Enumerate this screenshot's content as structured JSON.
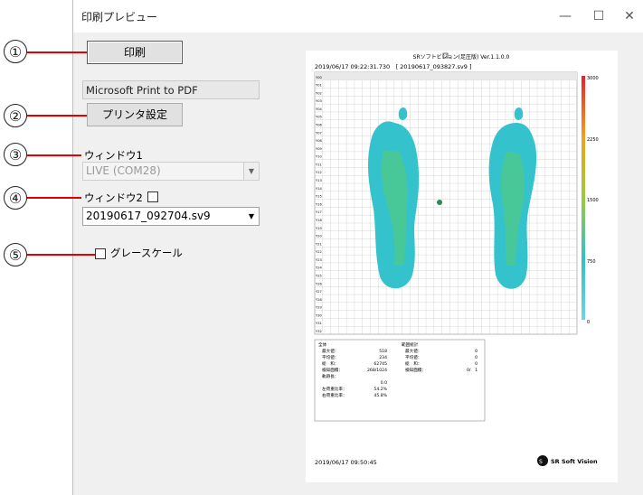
{
  "window": {
    "title": "印刷プレビュー",
    "min_glyph": "—",
    "max_glyph": "☐",
    "close_glyph": "✕"
  },
  "left": {
    "print_button": "印刷",
    "printer_name": "Microsoft Print to PDF",
    "printer_settings_button": "プリンタ設定",
    "window1_label": "ウィンドウ1",
    "window1_value": "LIVE (COM28)",
    "window2_label": "ウィンドウ2",
    "window2_checked": false,
    "window2_value": "20190617_092704.sv9",
    "grayscale_label": "グレースケール",
    "grayscale_checked": false
  },
  "callouts": [
    "①",
    "②",
    "③",
    "④",
    "⑤"
  ],
  "preview": {
    "header": "SRソフトビジョン(足圧版) Ver.1.1.0.0",
    "timestamp_line": "2019/06/17 09:22:31.730　[ 20190617_093827.sv9 ]",
    "row_labels": [
      "Y00",
      "Y01",
      "Y02",
      "Y03",
      "Y04",
      "Y05",
      "Y06",
      "Y07",
      "Y08",
      "Y09",
      "Y10",
      "Y11",
      "Y12",
      "Y13",
      "Y14",
      "Y15",
      "Y16",
      "Y17",
      "Y18",
      "Y19",
      "Y20",
      "Y21",
      "Y22",
      "Y23",
      "Y24",
      "Y25",
      "Y26",
      "Y27",
      "Y28",
      "Y29",
      "Y30",
      "Y31",
      "Y32"
    ],
    "scale_labels": [
      "3000",
      "2250",
      "1500",
      "750",
      "0"
    ],
    "stats_left": {
      "title": "全体",
      "rows": [
        {
          "label": "最大値：",
          "value": "518"
        },
        {
          "label": "平均値：",
          "value": "234"
        },
        {
          "label": "総　和：",
          "value": "62745"
        },
        {
          "label": "検知面積：",
          "value": "268/1024"
        },
        {
          "label": "軌跡長：",
          "value": ""
        },
        {
          "label": "",
          "value": "0.0"
        },
        {
          "label": "左荷重比率：",
          "value": "54.2%"
        },
        {
          "label": "右荷重比率：",
          "value": "45.8%"
        }
      ]
    },
    "stats_right": {
      "title": "範囲統計",
      "rows": [
        {
          "label": "最大値：",
          "value": "0"
        },
        {
          "label": "平均値：",
          "value": "0"
        },
        {
          "label": "総　和：",
          "value": "0"
        },
        {
          "label": "検知面積：",
          "value": "0/　1"
        }
      ]
    },
    "footer_date": "2019/06/17 09:50:45",
    "logo_text": "SR Soft Vision"
  }
}
